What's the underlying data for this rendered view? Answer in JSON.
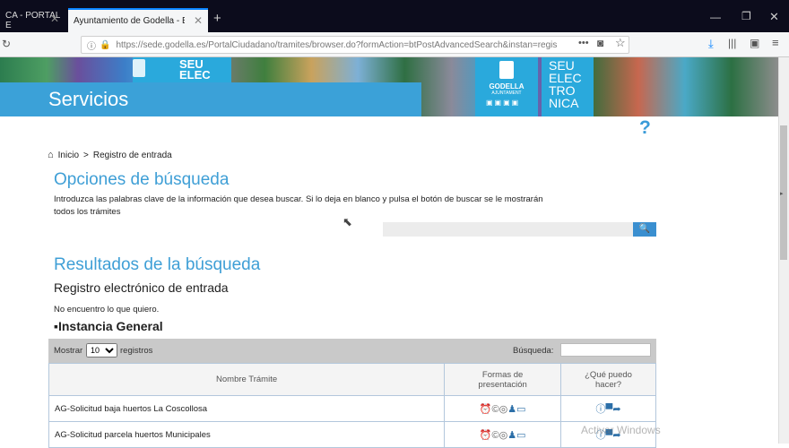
{
  "browser": {
    "tabs": [
      {
        "label": "CA - PORTAL E",
        "active": false
      },
      {
        "label": "Ayuntamiento de Godella - Bu",
        "active": true
      }
    ],
    "url": "https://sede.godella.es/PortalCiudadano/tramites/browser.do?formAction=btPostAdvancedSearch&instan=regis"
  },
  "banner": {
    "title": "Servicios",
    "seu_small": "SEU\nELEC",
    "seu_big": "SEU\nELEC\nTRO\nNICA",
    "godella": "GODELLA",
    "ajuntament": "AJUNTAMENT"
  },
  "help_glyph": "?",
  "breadcrumb": {
    "home": "Inicio",
    "sep": ">",
    "current": "Registro de entrada"
  },
  "search_options": {
    "heading": "Opciones de búsqueda",
    "description": "Introduzca las palabras clave de la información que desea buscar. Si lo deja en blanco y pulsa el botón de buscar se le mostrarán todos los trámites",
    "input_value": ""
  },
  "results": {
    "heading": "Resultados de la búsqueda",
    "subheading": "Registro electrónico de entrada",
    "not_found_link": "No encuentro lo que quiero.",
    "group_title": "Instancia General"
  },
  "table_controls": {
    "show_label": "Mostrar",
    "page_size": "10",
    "records_label": "registros",
    "search_label": "Búsqueda:",
    "search_value": ""
  },
  "table": {
    "headers": [
      "Nombre Trámite",
      "Formas de presentación",
      "¿Qué puedo hacer?"
    ],
    "rows": [
      {
        "name": "AG-Solicitud baja huertos La Coscollosa"
      },
      {
        "name": "AG-Solicitud parcela huertos Municipales"
      }
    ]
  },
  "watermark": "Activar Windows",
  "colors": {
    "accent": "#3ba1d8",
    "heading": "#3f9fd6",
    "tabbar": "#0c0c1c"
  }
}
